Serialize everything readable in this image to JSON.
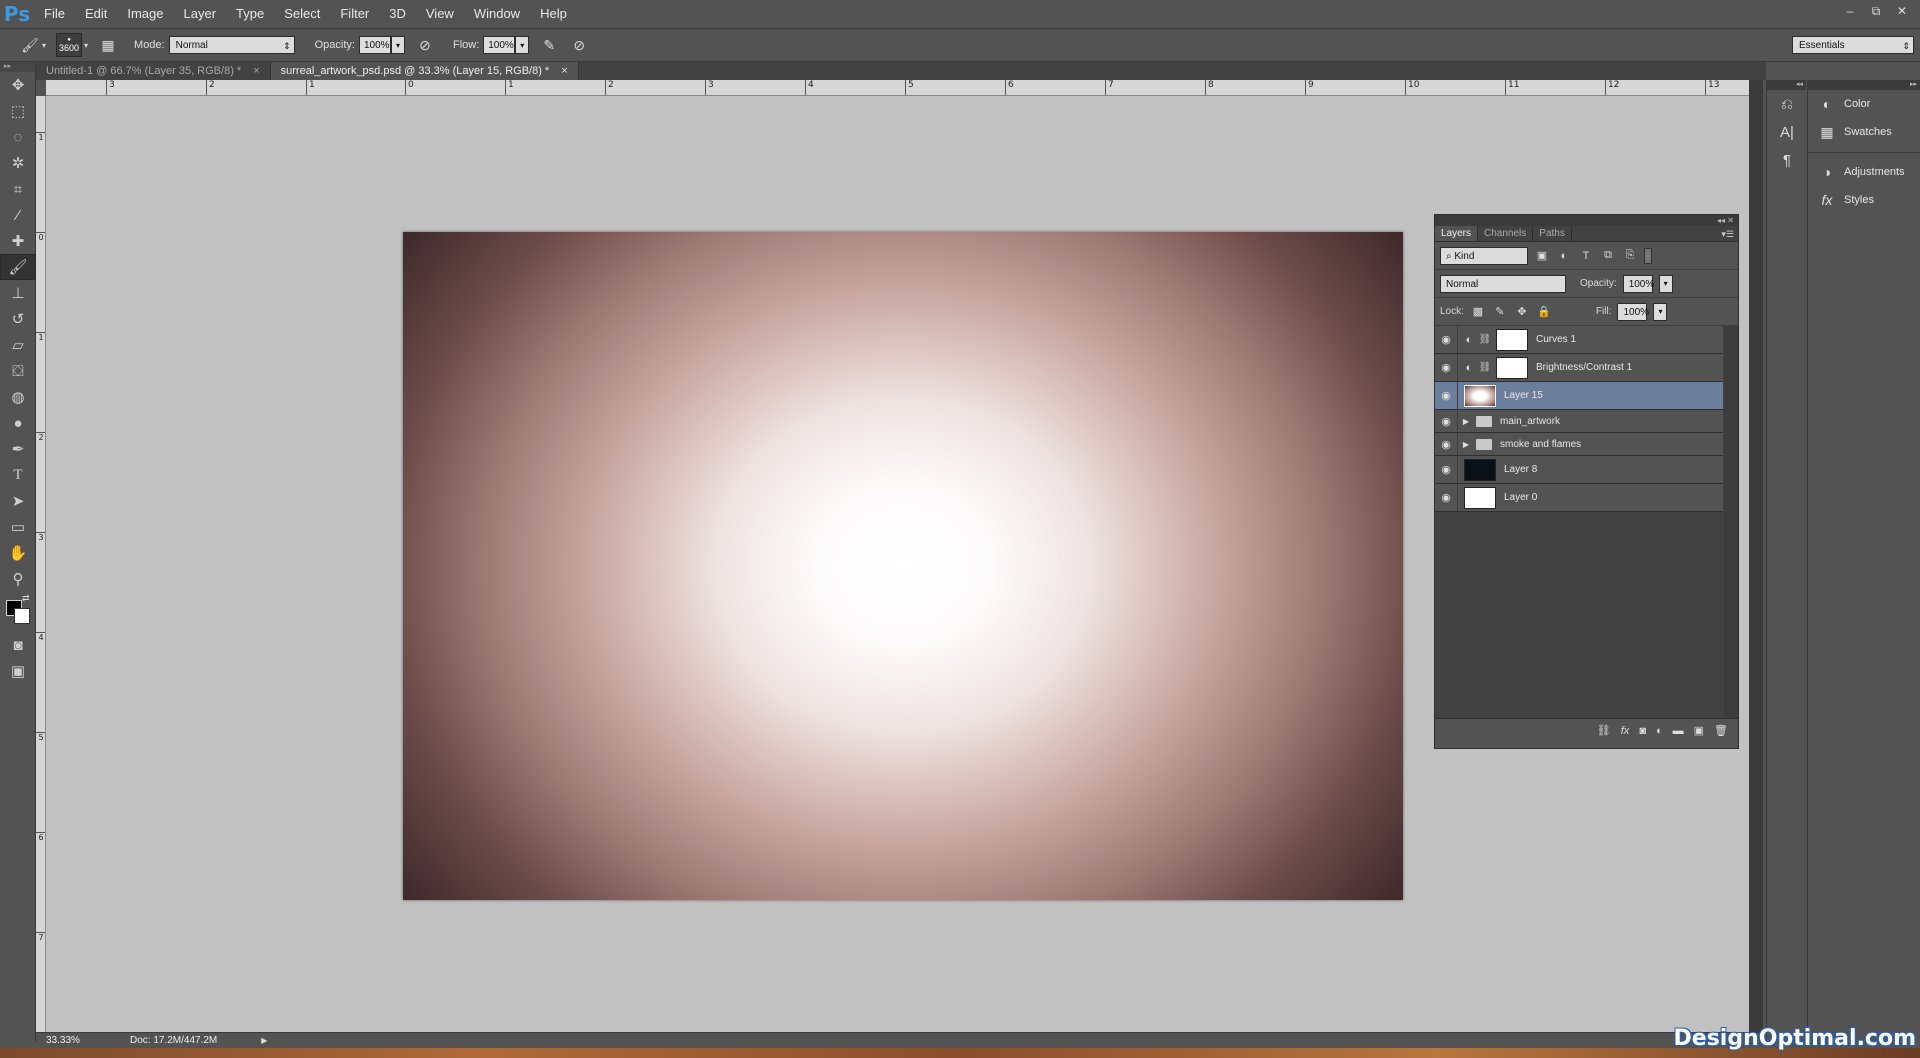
{
  "app": {
    "logo": "Ps"
  },
  "menu": [
    "File",
    "Edit",
    "Image",
    "Layer",
    "Type",
    "Select",
    "Filter",
    "3D",
    "View",
    "Window",
    "Help"
  ],
  "window_controls": [
    "–",
    "⧉",
    "✕"
  ],
  "options": {
    "brush_size": "3600",
    "mode_label": "Mode:",
    "mode_value": "Normal",
    "opacity_label": "Opacity:",
    "opacity_value": "100%",
    "flow_label": "Flow:",
    "flow_value": "100%",
    "workspace": "Essentials"
  },
  "tabs": [
    {
      "label": "Untitled-1 @ 66.7% (Layer 35, RGB/8) *",
      "close": "×"
    },
    {
      "label": "surreal_artwork_psd.psd @ 33.3% (Layer 15, RGB/8) *",
      "close": "×"
    }
  ],
  "ruler_top": [
    "3",
    "2",
    "1",
    "0",
    "1",
    "2",
    "3",
    "4",
    "5",
    "6",
    "7",
    "8",
    "9",
    "10",
    "11",
    "12",
    "13"
  ],
  "ruler_left": [
    "1",
    "0",
    "1",
    "2",
    "3",
    "4",
    "5",
    "6",
    "7"
  ],
  "status": {
    "zoom": "33.33%",
    "doc": "Doc: 17.2M/447.2M"
  },
  "dock_panels": [
    {
      "icon": "color-icon",
      "label": "Color"
    },
    {
      "icon": "swatches-icon",
      "label": "Swatches"
    },
    {
      "icon": "adjustments-icon",
      "label": "Adjustments"
    },
    {
      "icon": "styles-icon",
      "label": "Styles"
    }
  ],
  "layers_panel": {
    "tabs": [
      "Layers",
      "Channels",
      "Paths"
    ],
    "filter_kind": "Kind",
    "blend_mode": "Normal",
    "opacity_label": "Opacity:",
    "opacity_value": "100%",
    "lock_label": "Lock:",
    "fill_label": "Fill:",
    "fill_value": "100%",
    "layers": [
      {
        "name": "Curves 1",
        "type": "adjustment",
        "selected": false
      },
      {
        "name": "Brightness/Contrast 1",
        "type": "adjustment",
        "selected": false
      },
      {
        "name": "Layer 15",
        "type": "pixel",
        "selected": true
      },
      {
        "name": "main_artwork",
        "type": "group",
        "selected": false
      },
      {
        "name": "smoke and flames",
        "type": "group",
        "selected": false
      },
      {
        "name": "Layer 8",
        "type": "pixel",
        "selected": false
      },
      {
        "name": "Layer 0",
        "type": "pixel",
        "selected": false
      }
    ]
  },
  "watermark": "DesignOptimal.com",
  "colors": {
    "selected_layer": "#6b7f9c",
    "canvas_bg": "#c1c1c1",
    "ui": "#535353"
  }
}
